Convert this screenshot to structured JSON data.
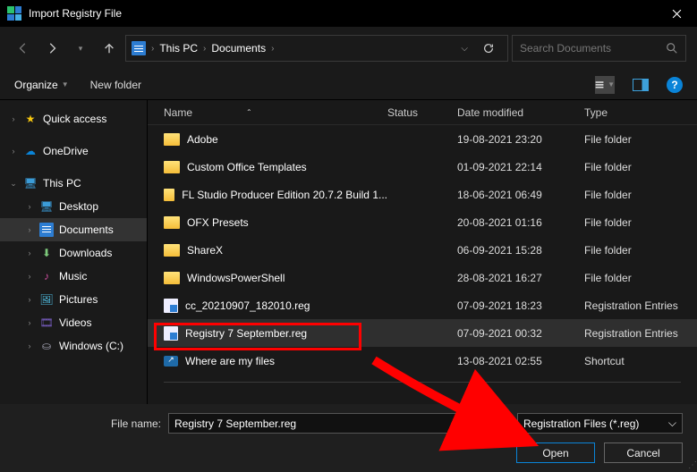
{
  "title": "Import Registry File",
  "breadcrumb": {
    "root": "This PC",
    "folder": "Documents"
  },
  "search": {
    "placeholder": "Search Documents"
  },
  "toolbar": {
    "organize": "Organize",
    "newfolder": "New folder"
  },
  "columns": {
    "name": "Name",
    "status": "Status",
    "date": "Date modified",
    "type": "Type"
  },
  "sidebar": {
    "quick": "Quick access",
    "onedrive": "OneDrive",
    "thispc": "This PC",
    "desktop": "Desktop",
    "documents": "Documents",
    "downloads": "Downloads",
    "music": "Music",
    "pictures": "Pictures",
    "videos": "Videos",
    "windowsc": "Windows (C:)"
  },
  "rows": [
    {
      "name": "Adobe",
      "date": "19-08-2021 23:20",
      "type": "File folder"
    },
    {
      "name": "Custom Office Templates",
      "date": "01-09-2021 22:14",
      "type": "File folder"
    },
    {
      "name": "FL Studio Producer Edition 20.7.2 Build 1...",
      "date": "18-06-2021 06:49",
      "type": "File folder"
    },
    {
      "name": "OFX Presets",
      "date": "20-08-2021 01:16",
      "type": "File folder"
    },
    {
      "name": "ShareX",
      "date": "06-09-2021 15:28",
      "type": "File folder"
    },
    {
      "name": "WindowsPowerShell",
      "date": "28-08-2021 16:27",
      "type": "File folder"
    },
    {
      "name": "cc_20210907_182010.reg",
      "date": "07-09-2021 18:23",
      "type": "Registration Entries"
    },
    {
      "name": "Registry 7 September.reg",
      "date": "07-09-2021 00:32",
      "type": "Registration Entries"
    },
    {
      "name": "Where are my files",
      "date": "13-08-2021 02:55",
      "type": "Shortcut"
    }
  ],
  "footer": {
    "filename_label": "File name:",
    "filename_value": "Registry 7 September.reg",
    "filter": "Registration Files (*.reg)",
    "open": "Open",
    "cancel": "Cancel"
  }
}
